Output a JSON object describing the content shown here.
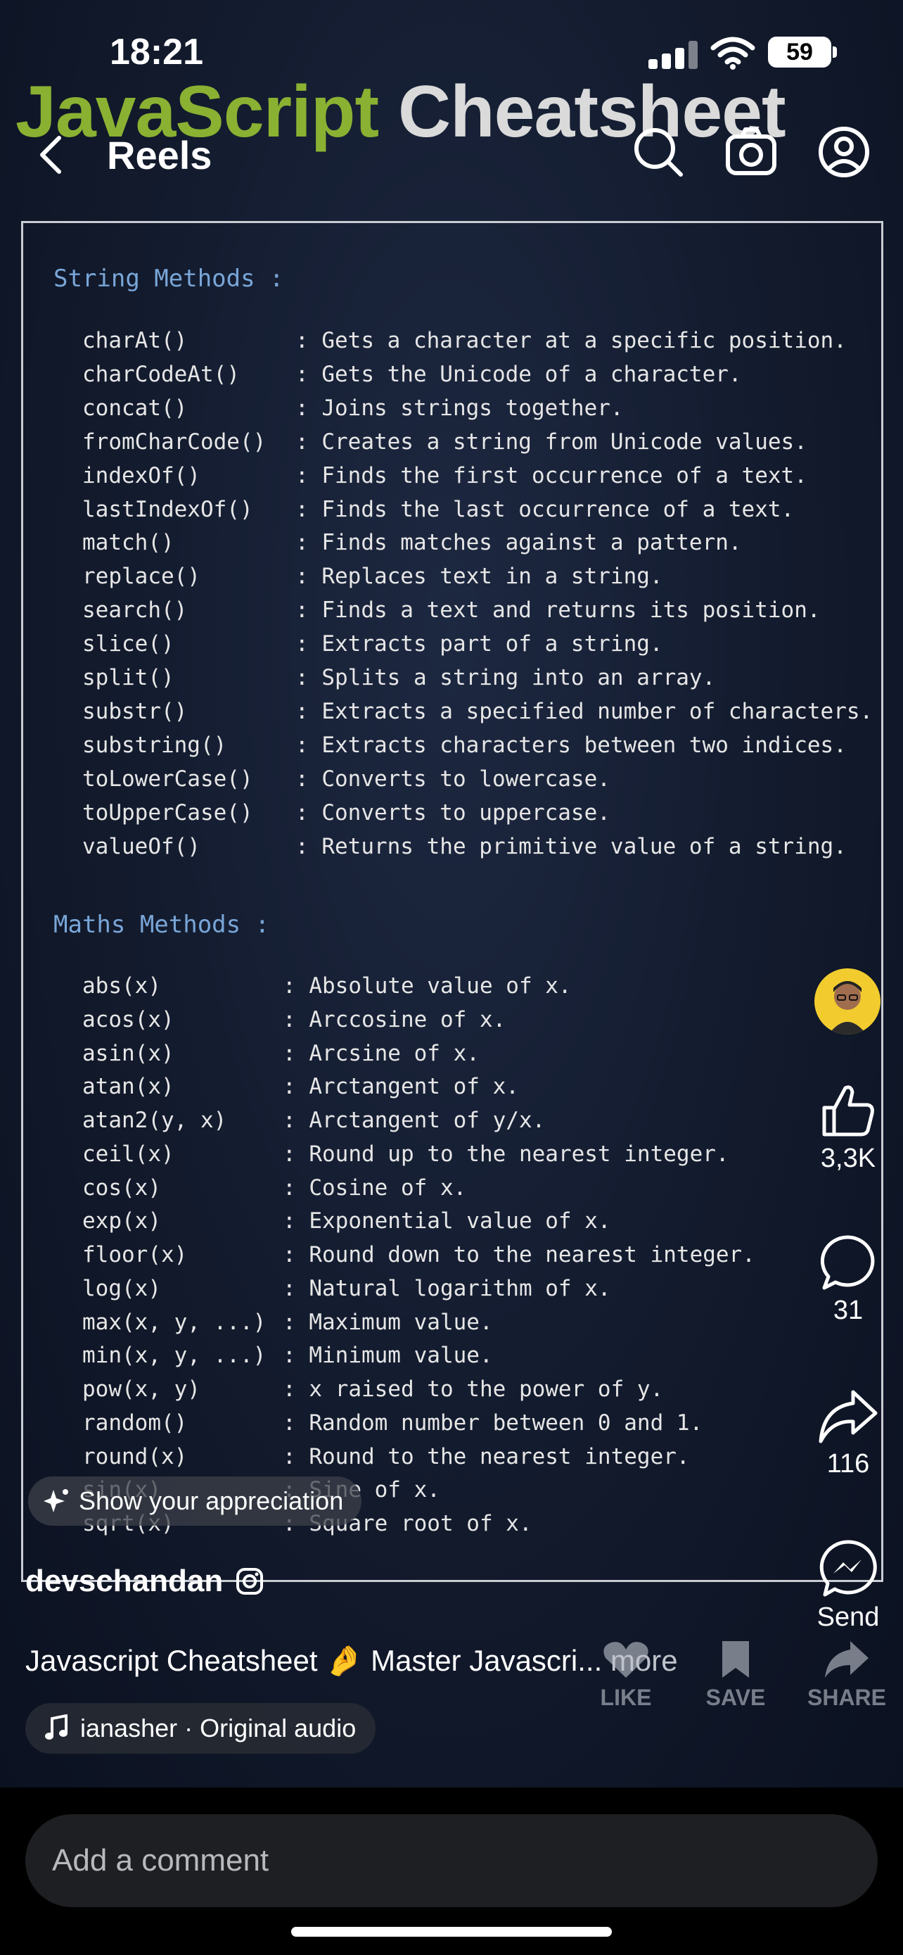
{
  "status": {
    "time": "18:21",
    "battery": "59"
  },
  "video_title": {
    "part1": "JavaScript",
    "part2": "Cheatsheet"
  },
  "nav": {
    "title": "Reels"
  },
  "cheatsheet": {
    "string_heading": "String Methods :",
    "string_methods": [
      {
        "name": "charAt()",
        "desc": ": Gets a character at a specific position."
      },
      {
        "name": "charCodeAt()",
        "desc": ": Gets the Unicode of a character."
      },
      {
        "name": "concat()",
        "desc": ": Joins strings together."
      },
      {
        "name": "fromCharCode()",
        "desc": ": Creates a string from Unicode values."
      },
      {
        "name": "indexOf()",
        "desc": ": Finds the first occurrence of a text."
      },
      {
        "name": "lastIndexOf()",
        "desc": ": Finds the last occurrence of a text."
      },
      {
        "name": "match()",
        "desc": ": Finds matches against a pattern."
      },
      {
        "name": "replace()",
        "desc": ": Replaces text in a string."
      },
      {
        "name": "search()",
        "desc": ": Finds a text and returns its position."
      },
      {
        "name": "slice()",
        "desc": ": Extracts part of a string."
      },
      {
        "name": "split()",
        "desc": ": Splits a string into an array."
      },
      {
        "name": "substr()",
        "desc": ": Extracts a specified number of characters."
      },
      {
        "name": "substring()",
        "desc": ": Extracts characters between two indices."
      },
      {
        "name": "toLowerCase()",
        "desc": ": Converts to lowercase."
      },
      {
        "name": "toUpperCase()",
        "desc": ": Converts to uppercase."
      },
      {
        "name": "valueOf()",
        "desc": ": Returns the primitive value of a string."
      }
    ],
    "maths_heading": "Maths Methods :",
    "maths_methods": [
      {
        "name": "abs(x)",
        "desc": ": Absolute value of x."
      },
      {
        "name": "acos(x)",
        "desc": ": Arccosine of x."
      },
      {
        "name": "asin(x)",
        "desc": ": Arcsine of x."
      },
      {
        "name": "atan(x)",
        "desc": ": Arctangent of x."
      },
      {
        "name": "atan2(y, x)",
        "desc": ": Arctangent of y/x."
      },
      {
        "name": "ceil(x)",
        "desc": ": Round up to the nearest integer."
      },
      {
        "name": "cos(x)",
        "desc": ": Cosine of x."
      },
      {
        "name": "exp(x)",
        "desc": ": Exponential value of x."
      },
      {
        "name": "floor(x)",
        "desc": ": Round down to the nearest integer."
      },
      {
        "name": "log(x)",
        "desc": ": Natural logarithm of x."
      },
      {
        "name": "max(x, y, ...)",
        "desc": ": Maximum value."
      },
      {
        "name": "min(x, y, ...)",
        "desc": ": Minimum value."
      },
      {
        "name": "pow(x, y)",
        "desc": ": x raised to the power of y."
      },
      {
        "name": "random()",
        "desc": ": Random number between 0 and 1."
      },
      {
        "name": "round(x)",
        "desc": ": Round to the nearest integer."
      },
      {
        "name": "sin(x)",
        "desc": ": Sine of x."
      },
      {
        "name": "sqrt(x)",
        "desc": ": Square root of x."
      }
    ]
  },
  "actions": {
    "likes": "3,3K",
    "comments": "31",
    "shares": "116",
    "send_label": "Send"
  },
  "overlay": {
    "appreciation": "Show your appreciation",
    "like_label": "LIKE",
    "save_label": "SAVE",
    "share_label": "SHARE"
  },
  "post": {
    "username": "devschandan",
    "caption": "Javascript Cheatsheet 🤌 Master Javascri...",
    "more": "more",
    "audio": "ianasher · Original audio"
  },
  "comment": {
    "placeholder": "Add a comment"
  },
  "colors": {
    "js_green": "#8ab132",
    "heading_blue": "#79a6d8",
    "avatar_yellow": "#f2cc2e"
  }
}
